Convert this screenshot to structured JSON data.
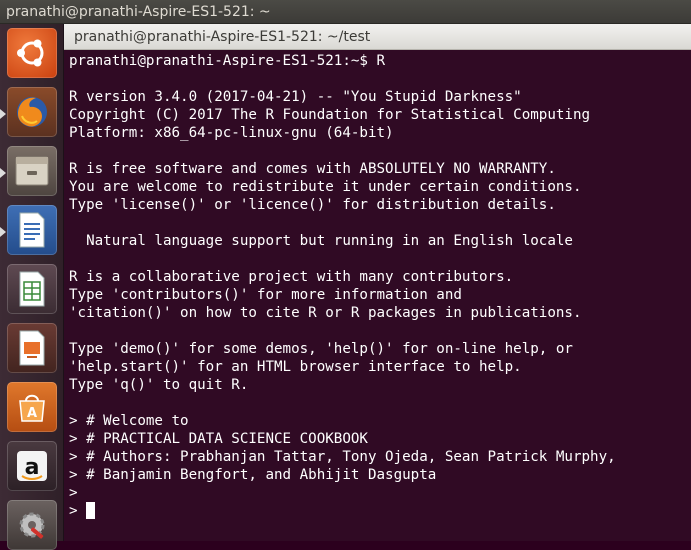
{
  "top_bar": {
    "title": "pranathi@pranathi-Aspire-ES1-521: ~"
  },
  "launcher": {
    "items": [
      {
        "name": "ubuntu-dash-icon"
      },
      {
        "name": "firefox-icon"
      },
      {
        "name": "files-icon"
      },
      {
        "name": "writer-icon"
      },
      {
        "name": "calc-icon"
      },
      {
        "name": "impress-icon"
      },
      {
        "name": "software-center-icon"
      },
      {
        "name": "amazon-icon"
      },
      {
        "name": "system-settings-icon"
      }
    ]
  },
  "window": {
    "title": "pranathi@pranathi-Aspire-ES1-521: ~/test"
  },
  "terminal": {
    "lines": [
      "pranathi@pranathi-Aspire-ES1-521:~$ R",
      "",
      "R version 3.4.0 (2017-04-21) -- \"You Stupid Darkness\"",
      "Copyright (C) 2017 The R Foundation for Statistical Computing",
      "Platform: x86_64-pc-linux-gnu (64-bit)",
      "",
      "R is free software and comes with ABSOLUTELY NO WARRANTY.",
      "You are welcome to redistribute it under certain conditions.",
      "Type 'license()' or 'licence()' for distribution details.",
      "",
      "  Natural language support but running in an English locale",
      "",
      "R is a collaborative project with many contributors.",
      "Type 'contributors()' for more information and",
      "'citation()' on how to cite R or R packages in publications.",
      "",
      "Type 'demo()' for some demos, 'help()' for on-line help, or",
      "'help.start()' for an HTML browser interface to help.",
      "Type 'q()' to quit R.",
      "",
      "> # Welcome to",
      "> # PRACTICAL DATA SCIENCE COOKBOOK",
      "> # Authors: Prabhanjan Tattar, Tony Ojeda, Sean Patrick Murphy,",
      "> # Banjamin Bengfort, and Abhijit Dasgupta",
      ">"
    ],
    "prompt": ">"
  },
  "colors": {
    "terminal_bg": "#300a24",
    "terminal_fg": "#ffffff",
    "topbar_bg": "#3c3b37",
    "ubuntu_orange": "#dd4814"
  }
}
